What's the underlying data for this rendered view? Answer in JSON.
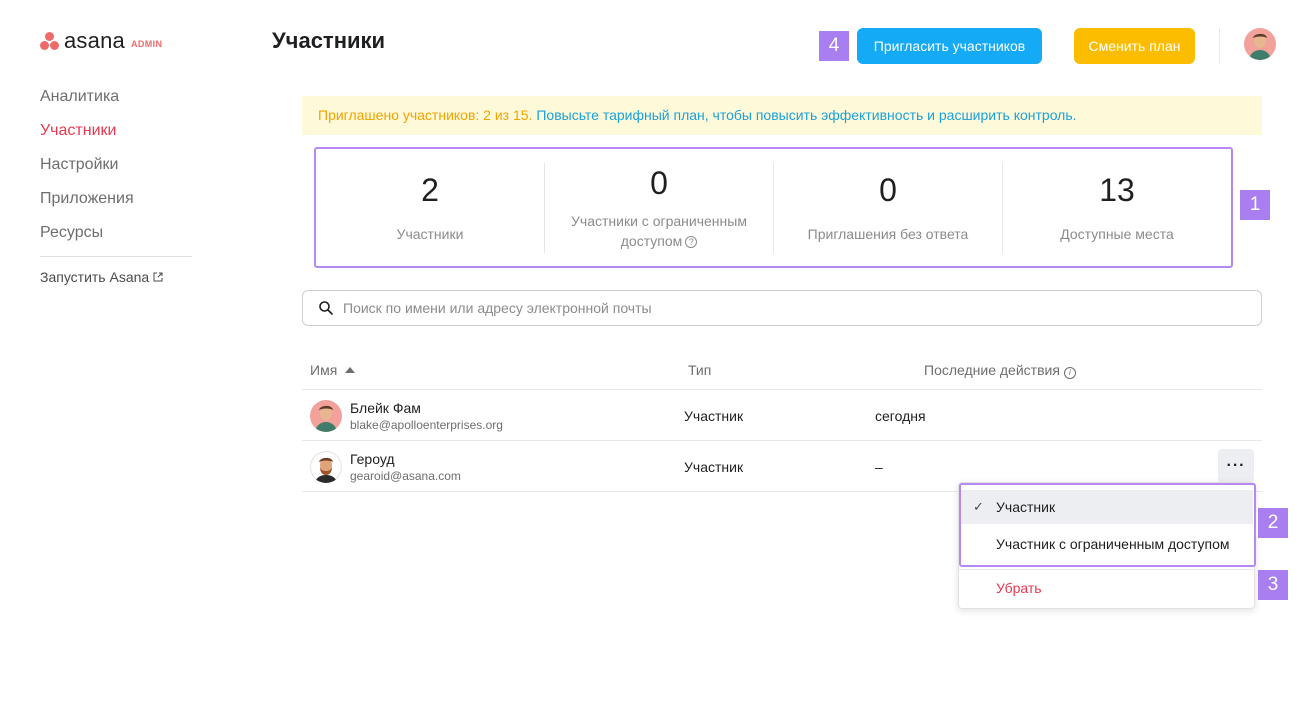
{
  "sidebar": {
    "logo_word": "asana",
    "logo_tag": "ADMIN",
    "items": [
      {
        "label": "Аналитика",
        "active": false
      },
      {
        "label": "Участники",
        "active": true
      },
      {
        "label": "Настройки",
        "active": false
      },
      {
        "label": "Приложения",
        "active": false
      },
      {
        "label": "Ресурсы",
        "active": false
      }
    ],
    "launch_label": "Запустить Asana",
    "launch_icon": "external-link-icon"
  },
  "header": {
    "title": "Участники",
    "invite_button": "Пригласить участников",
    "change_plan_button": "Сменить план",
    "invite_color": "#14aaf5",
    "plan_color": "#fcbd01"
  },
  "banner": {
    "warning": "Приглашено участников: 2 из 15.",
    "link": "Повысьте тарифный план, чтобы повысить эффективность и расширить контроль."
  },
  "stats": [
    {
      "value": "2",
      "label": "Участники"
    },
    {
      "value": "0",
      "label": "Участники с ограниченным доступом"
    },
    {
      "value": "0",
      "label": "Приглашения без ответа"
    },
    {
      "value": "13",
      "label": "Доступные места"
    }
  ],
  "search": {
    "placeholder": "Поиск по имени или адресу электронной почты",
    "value": ""
  },
  "table": {
    "columns": [
      "Имя",
      "Тип",
      "Последние действия"
    ],
    "rows": [
      {
        "name": "Блейк Фам",
        "email": "blake@apolloenterprises.org",
        "type": "Участник",
        "last_activity": "сегодня"
      },
      {
        "name": "Героуд",
        "email": "gearoid@asana.com",
        "type": "Участник",
        "last_activity": "–"
      }
    ]
  },
  "dropdown": {
    "options": [
      {
        "label": "Участник",
        "selected": true
      },
      {
        "label": "Участник с ограниченным доступом",
        "selected": false
      }
    ],
    "remove_label": "Убрать"
  },
  "annotations": [
    "1",
    "2",
    "3",
    "4"
  ],
  "colors": {
    "accent_red": "#e8384f",
    "annotation_purple": "#a87ef0",
    "banner_bg": "#fef9d8"
  }
}
